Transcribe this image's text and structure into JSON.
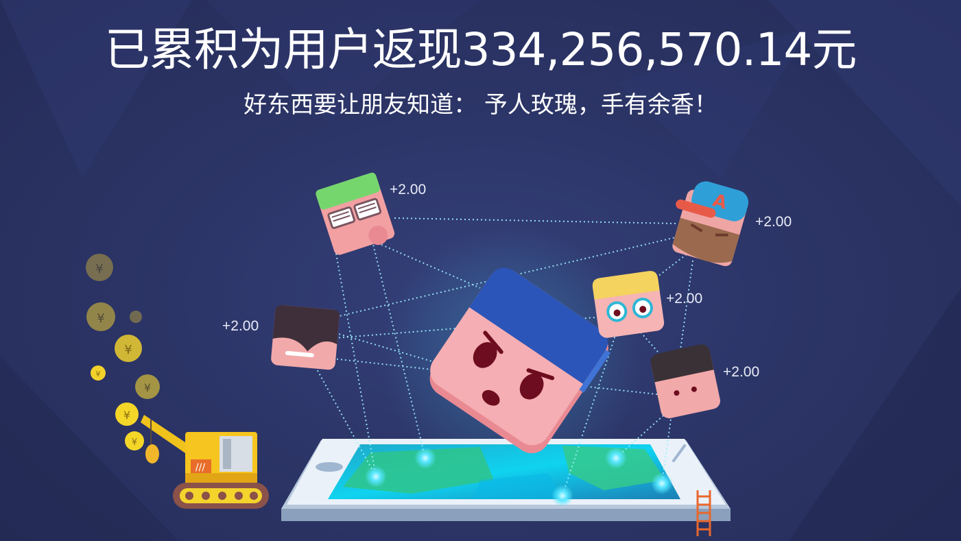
{
  "headline": {
    "prefix": "已累积为用户返现",
    "amount": "334,256,570.14",
    "unit": "元"
  },
  "subheadline": "好东西要让朋友知道： 予人玫瑰，手有余香！",
  "rewards": [
    "+2.00",
    "+2.00",
    "+2.00",
    "+2.00",
    "+2.00"
  ],
  "colors": {
    "background": "#2a3362",
    "accent_blue": "#2b55b8",
    "glow": "#57e6ff",
    "text": "#ffffff"
  },
  "icons": [
    "coin-icon",
    "crane-icon",
    "phone-icon",
    "ladder-icon",
    "avatar-icon"
  ]
}
